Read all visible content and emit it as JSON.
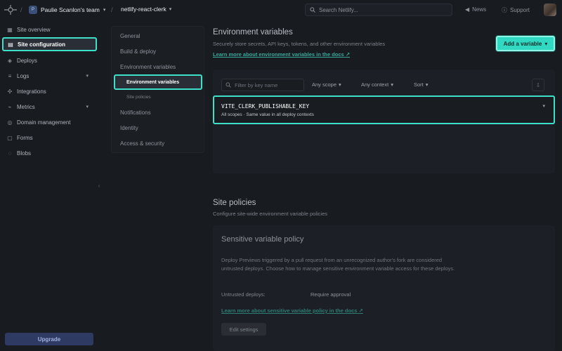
{
  "topbar": {
    "team_avatar": "P",
    "team": "Paulie Scanlon's team",
    "site": "netlify-react-clerk",
    "search_placeholder": "Search Netlify...",
    "news": "News",
    "support": "Support"
  },
  "sidebar": {
    "items": [
      {
        "label": "Site overview",
        "icon": "grid-icon"
      },
      {
        "label": "Site configuration",
        "icon": "config-icon"
      },
      {
        "label": "Deploys",
        "icon": "deploy-icon"
      },
      {
        "label": "Logs",
        "icon": "logs-icon"
      },
      {
        "label": "Integrations",
        "icon": "integrations-icon"
      },
      {
        "label": "Metrics",
        "icon": "metrics-icon"
      },
      {
        "label": "Domain management",
        "icon": "globe-icon"
      },
      {
        "label": "Forms",
        "icon": "forms-icon"
      },
      {
        "label": "Blobs",
        "icon": "blobs-icon"
      }
    ],
    "upgrade": "Upgrade"
  },
  "subnav": {
    "general": "General",
    "build_deploy": "Build & deploy",
    "env_vars": "Environment variables",
    "env_vars_sub": "Environment variables",
    "site_policies": "Site policies",
    "notifications": "Notifications",
    "identity": "Identity",
    "access_security": "Access & security"
  },
  "env": {
    "title": "Environment variables",
    "subtitle": "Securely store secrets, API keys, tokens, and other environment variables",
    "docs_link": "Learn more about environment variables in the docs",
    "add_button": "Add a variable",
    "filter_placeholder": "Filter by key name",
    "scope": "Any scope",
    "context": "Any context",
    "sort": "Sort",
    "variables": [
      {
        "key": "VITE_CLERK_PUBLISHABLE_KEY",
        "scopes": "All scopes",
        "contexts": "Same value in all deploy contexts"
      }
    ]
  },
  "policies": {
    "title": "Site policies",
    "subtitle": "Configure site-wide environment variable policies",
    "card_title": "Sensitive variable policy",
    "description": "Deploy Previews triggered by a pull request from an unrecognized author's fork are considered untrusted deploys. Choose how to manage sensitive environment variable access for these deploys.",
    "untrusted_label": "Untrusted deploys:",
    "untrusted_value": "Require approval",
    "docs_link": "Learn more about sensitive variable policy in the docs",
    "edit_button": "Edit settings"
  },
  "colors": {
    "accent": "#3ee0c9",
    "background": "#181b20"
  }
}
